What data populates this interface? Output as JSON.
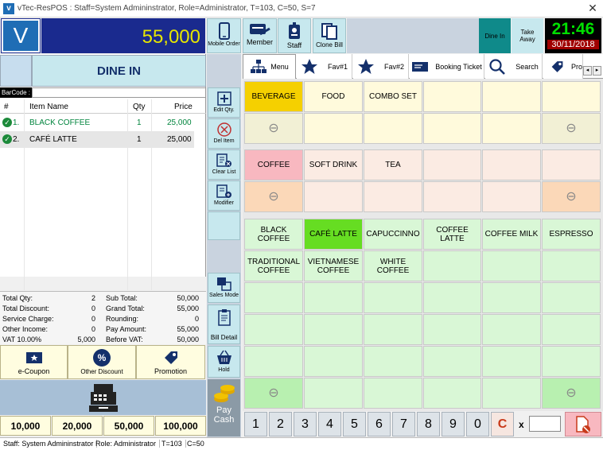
{
  "window": {
    "title": "vTec-ResPOS : Staff=System Admininstrator, Role=Administrator, T=103, C=50, S=7",
    "logo_letter": "V"
  },
  "header": {
    "amount": "55,000",
    "mode_label": "DINE IN",
    "time": "21:46",
    "date": "30/11/2018",
    "dine_in_label": "Dine In",
    "take_away_label": "Take Away"
  },
  "toolbar": {
    "mobile_order": "Mobile Order",
    "member": "Member",
    "staff": "Staff",
    "clone_bill": "Clone Bill"
  },
  "tabs": {
    "menu": "Menu",
    "fav1": "Fav#1",
    "fav2": "Fav#2",
    "booking": "Booking Ticket",
    "search": "Search",
    "pro": "Pro"
  },
  "barcode": {
    "label": "BarCode :",
    "value": ""
  },
  "order_table": {
    "headers": {
      "no": "#",
      "name": "Item Name",
      "qty": "Qty",
      "price": "Price"
    },
    "rows": [
      {
        "no": "1.",
        "name": "BLACK COFFEE",
        "qty": "1",
        "price": "25,000"
      },
      {
        "no": "2.",
        "name": "CAFÉ LATTE",
        "qty": "1",
        "price": "25,000"
      }
    ]
  },
  "side_buttons": {
    "edit_qty": "Edit Qty.",
    "del_item": "Del Item",
    "clear_list": "Clear List",
    "modifier": "Modifier",
    "sales_mode": "Sales Mode",
    "bill_detail": "Bill Detail",
    "hold": "Hold",
    "pay_cash": "Pay Cash"
  },
  "summary": {
    "total_qty_label": "Total Qty:",
    "total_qty": "2",
    "total_discount_label": "Total Discount:",
    "total_discount": "0",
    "service_charge_label": "Service Charge:",
    "service_charge": "0",
    "other_income_label": "Other Income:",
    "other_income": "0",
    "vat_label": "VAT 10.00%",
    "vat": "5,000",
    "sub_total_label": "Sub Total:",
    "sub_total": "50,000",
    "grand_total_label": "Grand Total:",
    "grand_total": "55,000",
    "rounding_label": "Rounding:",
    "rounding": "0",
    "pay_amount_label": "Pay Amount:",
    "pay_amount": "55,000",
    "before_vat_label": "Before VAT:",
    "before_vat": "50,000"
  },
  "promo": {
    "ecoupon": "e-Coupon",
    "other_discount": "Other Discount",
    "promotion": "Promotion"
  },
  "cash_buttons": [
    "10,000",
    "20,000",
    "50,000",
    "100,000"
  ],
  "groups": [
    "BEVERAGE",
    "FOOD",
    "COMBO SET"
  ],
  "subgroups": [
    "COFFEE",
    "SOFT DRINK",
    "TEA"
  ],
  "products": [
    "BLACK COFFEE",
    "CAFÉ LATTE",
    "CAPUCCINNO",
    "COFFEE LATTE",
    "COFFEE MILK",
    "ESPRESSO",
    "TRADITIONAL COFFEE",
    "VIETNAMESE COFFEE",
    "WHITE COFFEE"
  ],
  "numpad": {
    "keys": [
      "1",
      "2",
      "3",
      "4",
      "5",
      "6",
      "7",
      "8",
      "9",
      "0"
    ],
    "clear": "C",
    "multiply": "x",
    "qty_value": ""
  },
  "statusbar": {
    "staff": "Staff: System Admininstrator",
    "role": "Role: Administrator",
    "t": "T=103",
    "c": "C=50"
  },
  "colors": {
    "header_blue": "#1a2a8e",
    "amount_yellow": "#e6e600",
    "clock_green": "#00e000",
    "selected_group": "#f5d000",
    "selected_subgroup": "#f8b8c0",
    "selected_product": "#66dd22"
  }
}
